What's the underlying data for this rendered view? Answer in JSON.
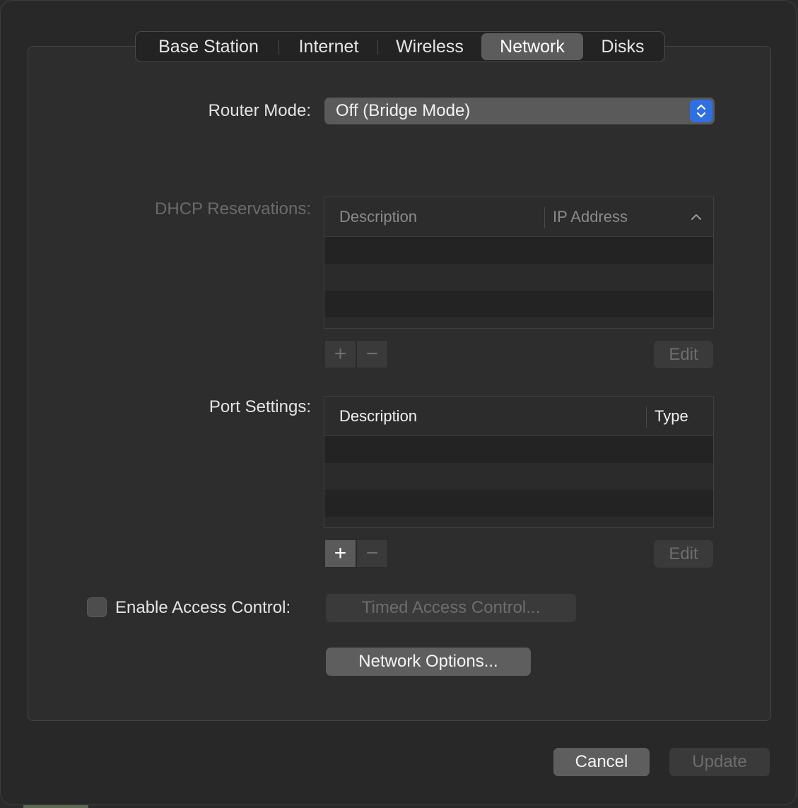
{
  "tabs": [
    {
      "label": "Base Station",
      "active": false
    },
    {
      "label": "Internet",
      "active": false
    },
    {
      "label": "Wireless",
      "active": false
    },
    {
      "label": "Network",
      "active": true
    },
    {
      "label": "Disks",
      "active": false
    }
  ],
  "router_mode": {
    "label": "Router Mode:",
    "value": "Off (Bridge Mode)"
  },
  "dhcp": {
    "label": "DHCP Reservations:",
    "columns": [
      "Description",
      "IP Address"
    ],
    "sort_icon": "chevron-up-icon",
    "rows": [],
    "add_label": "+",
    "remove_label": "−",
    "edit_label": "Edit"
  },
  "ports": {
    "label": "Port Settings:",
    "columns": [
      "Description",
      "Type"
    ],
    "rows": [],
    "add_label": "+",
    "remove_label": "−",
    "edit_label": "Edit"
  },
  "access_control": {
    "label": "Enable Access Control:",
    "checked": false,
    "timed_button": "Timed Access Control..."
  },
  "network_options_button": "Network Options...",
  "footer": {
    "cancel": "Cancel",
    "update": "Update"
  },
  "colors": {
    "accent": "#2f6fe0",
    "active_tab": "#5c5c5c"
  }
}
